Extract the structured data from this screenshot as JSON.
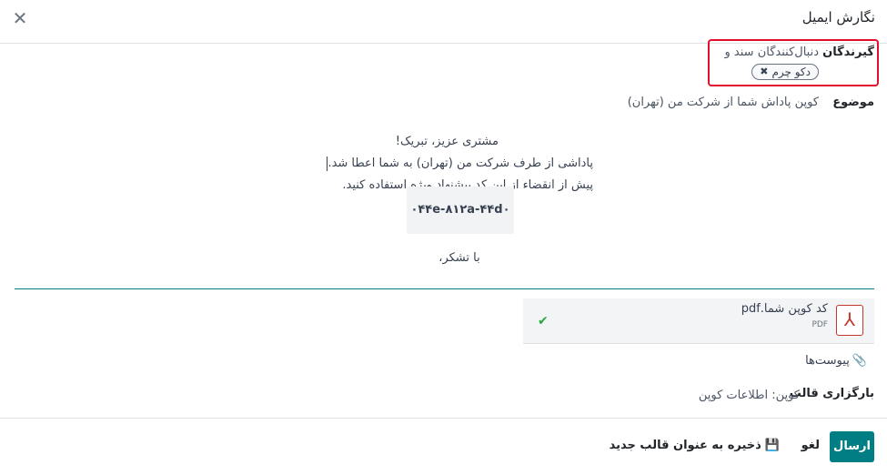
{
  "dialog": {
    "title": "نگارش ایمیل",
    "close_icon": "close-icon"
  },
  "recipients": {
    "label": "گیرندگان",
    "text": "دنبال‌کنندگان سند و",
    "tag": "دکو چرم",
    "tag_remove_icon": "x-icon"
  },
  "subject": {
    "label": "موضوع",
    "value": "کوپن پاداش شما از شرکت من (تهران)"
  },
  "body": {
    "greeting": "مشتری عزیز، تبریک!",
    "line1": "پاداشی از طرف شرکت من (تهران) به شما اعطا شد.",
    "line2": "پیش از انقضاء از این کد پیشنهاد ویژه استفاده کنید.",
    "code": "۰۴۴e-۸۱۲a-۴۴d۰",
    "thanks": "با تشکر،"
  },
  "attachment": {
    "name": "کد کوپن شما.pdf",
    "type": "PDF",
    "icon": "pdf-icon",
    "status_icon": "check-icon"
  },
  "attachments_link": {
    "label": "پیوست‌ها",
    "icon": "paperclip-icon"
  },
  "template": {
    "label": "بارگزاری قالب",
    "value": "کوپن: اطلاعات کوپن"
  },
  "footer": {
    "send": "ارسال",
    "cancel": "لغو",
    "save_template": "ذخیره به عنوان قالب جدید",
    "save_icon": "floppy-disk-icon"
  },
  "colors": {
    "primary": "#017e84",
    "highlight_border": "#e0102c",
    "pdf_red": "#c0392b",
    "check_green": "#28a745"
  }
}
